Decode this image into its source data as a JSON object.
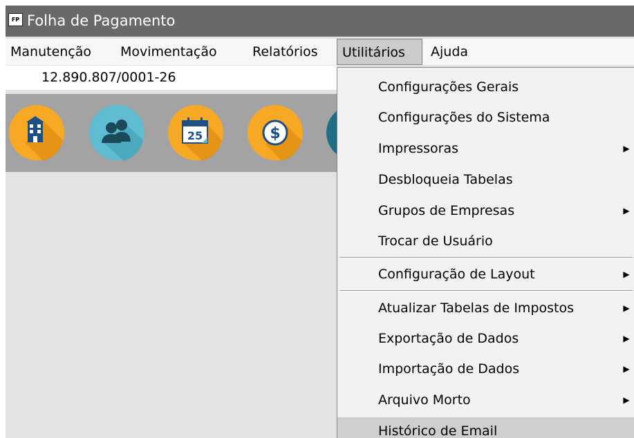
{
  "window": {
    "icon_text": "FP",
    "title": "Folha de Pagamento"
  },
  "menubar": {
    "items": [
      {
        "label": "Manutenção"
      },
      {
        "label": "Movimentação"
      },
      {
        "label": "Relatórios"
      },
      {
        "label": "Utilitários"
      },
      {
        "label": "Ajuda"
      }
    ]
  },
  "company": {
    "cnpj": "12.890.807/0001-26"
  },
  "toolbar": {
    "icons": [
      "building-icon",
      "users-icon",
      "calendar-icon",
      "dollar-icon",
      "partial-icon"
    ],
    "calendar_day": "25",
    "dollar_symbol": "$"
  },
  "dropdown": {
    "items": [
      {
        "label": "Configurações Gerais",
        "submenu": false
      },
      {
        "label": "Configurações do Sistema",
        "submenu": false
      },
      {
        "label": "Impressoras",
        "submenu": true
      },
      {
        "label": "Desbloqueia Tabelas",
        "submenu": false
      },
      {
        "label": "Grupos de Empresas",
        "submenu": true
      },
      {
        "label": "Trocar de Usuário",
        "submenu": false
      },
      {
        "label": "Configuração de Layout",
        "submenu": true
      },
      {
        "label": "Atualizar Tabelas de Impostos",
        "submenu": true
      },
      {
        "label": "Exportação de Dados",
        "submenu": true
      },
      {
        "label": "Importação de Dados",
        "submenu": true
      },
      {
        "label": "Arquivo Morto",
        "submenu": true
      },
      {
        "label": "Histórico de Email",
        "submenu": false,
        "highlighted": true
      }
    ],
    "submenu_arrow": "▶"
  },
  "colors": {
    "titlebar": "#696969",
    "menubar": "#f7f7f7",
    "toolbar": "#a3a3a3",
    "menu_highlight": "#cfcfcf",
    "icon_orange": "#f7a824",
    "icon_teal": "#60bcd0"
  }
}
